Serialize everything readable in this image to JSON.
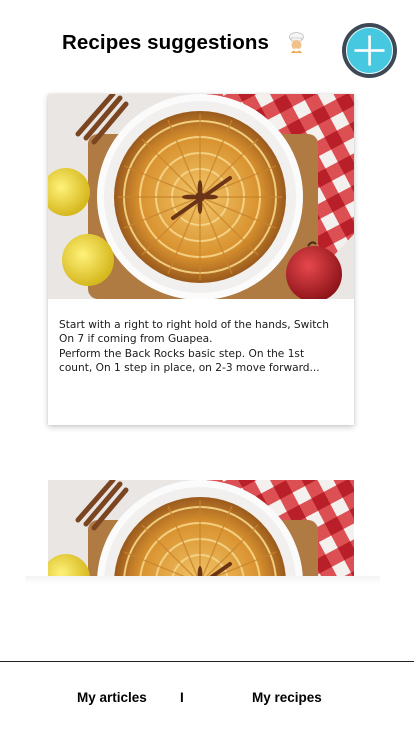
{
  "header": {
    "title": "Recipes suggestions",
    "title_icon": "chef-icon",
    "add_button_icon": "plus-icon",
    "accent_color": "#46c9e0"
  },
  "recipes": [
    {
      "image": "apple-tart-photo",
      "description_lines": [
        "Start with a right to right hold of the hands, Switch On 7 if coming from Guapea.",
        "Perform the Back Rocks basic step. On the 1st count, On 1 step in place, on 2-3 move forward..."
      ]
    },
    {
      "image": "apple-tart-photo"
    }
  ],
  "bottom_nav": {
    "articles_label": "My articles",
    "separator": "I",
    "recipes_label": "My recipes"
  }
}
